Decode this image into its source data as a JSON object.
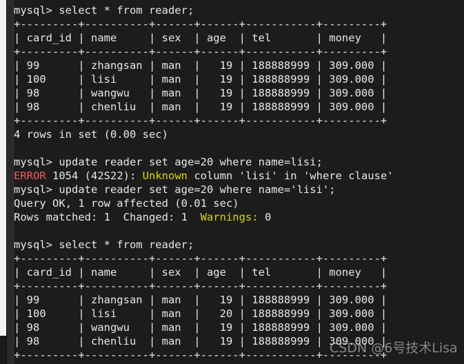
{
  "terminal": {
    "background_color": "#1c1c1c",
    "foreground_color": "#e8e8e8",
    "error_color": "#f05b5b",
    "warning_color": "#d8d800",
    "prompt": "mysql>"
  },
  "scrollbar": {
    "name": "vertical-scrollbar",
    "thumb_color": "#f2f2f2",
    "track_color": "#2a2a2a"
  },
  "watermark": {
    "text": "CSDN @6号技术Lisa"
  },
  "table_schema": {
    "columns": [
      "card_id",
      "name",
      "sex",
      "age",
      "tel",
      "money"
    ],
    "widths": [
      9,
      10,
      6,
      6,
      11,
      9
    ],
    "separator": "+---------+----------+------+------+-----------+---------+",
    "header_row": "| card_id | name     | sex  | age  | tel       | money   |"
  },
  "lines": [
    {
      "id": "l01",
      "segments": [
        {
          "text": "mysql> select * from reader;",
          "color": "default"
        }
      ]
    },
    {
      "id": "l02",
      "segments": [
        {
          "text": "+---------+----------+------+------+-----------+---------+",
          "color": "rule"
        }
      ]
    },
    {
      "id": "l03",
      "segments": [
        {
          "text": "| card_id | name     | sex  | age  | tel       | money   |",
          "color": "default"
        }
      ]
    },
    {
      "id": "l04",
      "segments": [
        {
          "text": "+---------+----------+------+------+-----------+---------+",
          "color": "rule"
        }
      ]
    },
    {
      "id": "l05",
      "segments": [
        {
          "text": "| 99      | zhangsan | man  |   19 | 188888999 | 309.000 |",
          "color": "default"
        }
      ]
    },
    {
      "id": "l06",
      "segments": [
        {
          "text": "| 100     | lisi     | man  |   19 | 188888999 | 309.000 |",
          "color": "default"
        }
      ]
    },
    {
      "id": "l07",
      "segments": [
        {
          "text": "| 98      | wangwu   | man  |   19 | 188888999 | 309.000 |",
          "color": "default"
        }
      ]
    },
    {
      "id": "l08",
      "segments": [
        {
          "text": "| 98      | chenliu  | man  |   19 | 188888999 | 309.000 |",
          "color": "default"
        }
      ]
    },
    {
      "id": "l09",
      "segments": [
        {
          "text": "+---------+----------+------+------+-----------+---------+",
          "color": "rule"
        }
      ]
    },
    {
      "id": "l10",
      "segments": [
        {
          "text": "4 rows in set (0.00 sec)",
          "color": "default"
        }
      ]
    },
    {
      "id": "l11",
      "segments": [
        {
          "text": " ",
          "color": "default"
        }
      ]
    },
    {
      "id": "l12",
      "segments": [
        {
          "text": "mysql> update reader set age=20 where name=lisi;",
          "color": "default"
        }
      ]
    },
    {
      "id": "l13",
      "segments": [
        {
          "text": "ERROR",
          "color": "error"
        },
        {
          "text": " 1054 (42S22): ",
          "color": "default"
        },
        {
          "text": "Unknown",
          "color": "warn"
        },
        {
          "text": " column 'lisi' in 'where clause'",
          "color": "default"
        }
      ]
    },
    {
      "id": "l14",
      "segments": [
        {
          "text": "mysql> update reader set age=20 where name='lisi';",
          "color": "default"
        }
      ]
    },
    {
      "id": "l15",
      "segments": [
        {
          "text": "Query OK, 1 row affected (0.01 sec)",
          "color": "default"
        }
      ]
    },
    {
      "id": "l16",
      "segments": [
        {
          "text": "Rows matched: 1  Changed: 1  ",
          "color": "default"
        },
        {
          "text": "Warnings:",
          "color": "warn"
        },
        {
          "text": " 0",
          "color": "default"
        }
      ]
    },
    {
      "id": "l17",
      "segments": [
        {
          "text": " ",
          "color": "default"
        }
      ]
    },
    {
      "id": "l18",
      "segments": [
        {
          "text": "mysql> select * from reader;",
          "color": "default"
        }
      ]
    },
    {
      "id": "l19",
      "segments": [
        {
          "text": "+---------+----------+------+------+-----------+---------+",
          "color": "rule"
        }
      ]
    },
    {
      "id": "l20",
      "segments": [
        {
          "text": "| card_id | name     | sex  | age  | tel       | money   |",
          "color": "default"
        }
      ]
    },
    {
      "id": "l21",
      "segments": [
        {
          "text": "+---------+----------+------+------+-----------+---------+",
          "color": "rule"
        }
      ]
    },
    {
      "id": "l22",
      "segments": [
        {
          "text": "| 99      | zhangsan | man  |   19 | 188888999 | 309.000 |",
          "color": "default"
        }
      ]
    },
    {
      "id": "l23",
      "segments": [
        {
          "text": "| 100     | lisi     | man  |   20 | 188888999 | 309.000 |",
          "color": "default"
        }
      ]
    },
    {
      "id": "l24",
      "segments": [
        {
          "text": "| 98      | wangwu   | man  |   19 | 188888999 | 309.000 |",
          "color": "default"
        }
      ]
    },
    {
      "id": "l25",
      "segments": [
        {
          "text": "| 98      | chenliu  | man  |   19 | 188888999 | 309.000 |",
          "color": "default"
        }
      ]
    },
    {
      "id": "l26",
      "segments": [
        {
          "text": "+---------+----------+------+------+-----------+---------+",
          "color": "rule"
        }
      ]
    }
  ],
  "result_sets": [
    {
      "query": "select * from reader;",
      "columns": [
        "card_id",
        "name",
        "sex",
        "age",
        "tel",
        "money"
      ],
      "rows": [
        [
          "99",
          "zhangsan",
          "man",
          "19",
          "188888999",
          "309.000"
        ],
        [
          "100",
          "lisi",
          "man",
          "19",
          "188888999",
          "309.000"
        ],
        [
          "98",
          "wangwu",
          "man",
          "19",
          "188888999",
          "309.000"
        ],
        [
          "98",
          "chenliu",
          "man",
          "19",
          "188888999",
          "309.000"
        ]
      ],
      "footer": "4 rows in set (0.00 sec)"
    },
    {
      "query": "select * from reader;",
      "columns": [
        "card_id",
        "name",
        "sex",
        "age",
        "tel",
        "money"
      ],
      "rows": [
        [
          "99",
          "zhangsan",
          "man",
          "19",
          "188888999",
          "309.000"
        ],
        [
          "100",
          "lisi",
          "man",
          "20",
          "188888999",
          "309.000"
        ],
        [
          "98",
          "wangwu",
          "man",
          "19",
          "188888999",
          "309.000"
        ],
        [
          "98",
          "chenliu",
          "man",
          "19",
          "188888999",
          "309.000"
        ]
      ],
      "footer": ""
    }
  ],
  "statements": [
    {
      "text": "select * from reader;",
      "status": "ok"
    },
    {
      "text": "update reader set age=20 where name=lisi;",
      "status": "error",
      "message": "ERROR 1054 (42S22): Unknown column 'lisi' in 'where clause'"
    },
    {
      "text": "update reader set age=20 where name='lisi';",
      "status": "ok",
      "message": "Query OK, 1 row affected (0.01 sec)",
      "detail": "Rows matched: 1  Changed: 1  Warnings: 0"
    },
    {
      "text": "select * from reader;",
      "status": "ok"
    }
  ]
}
